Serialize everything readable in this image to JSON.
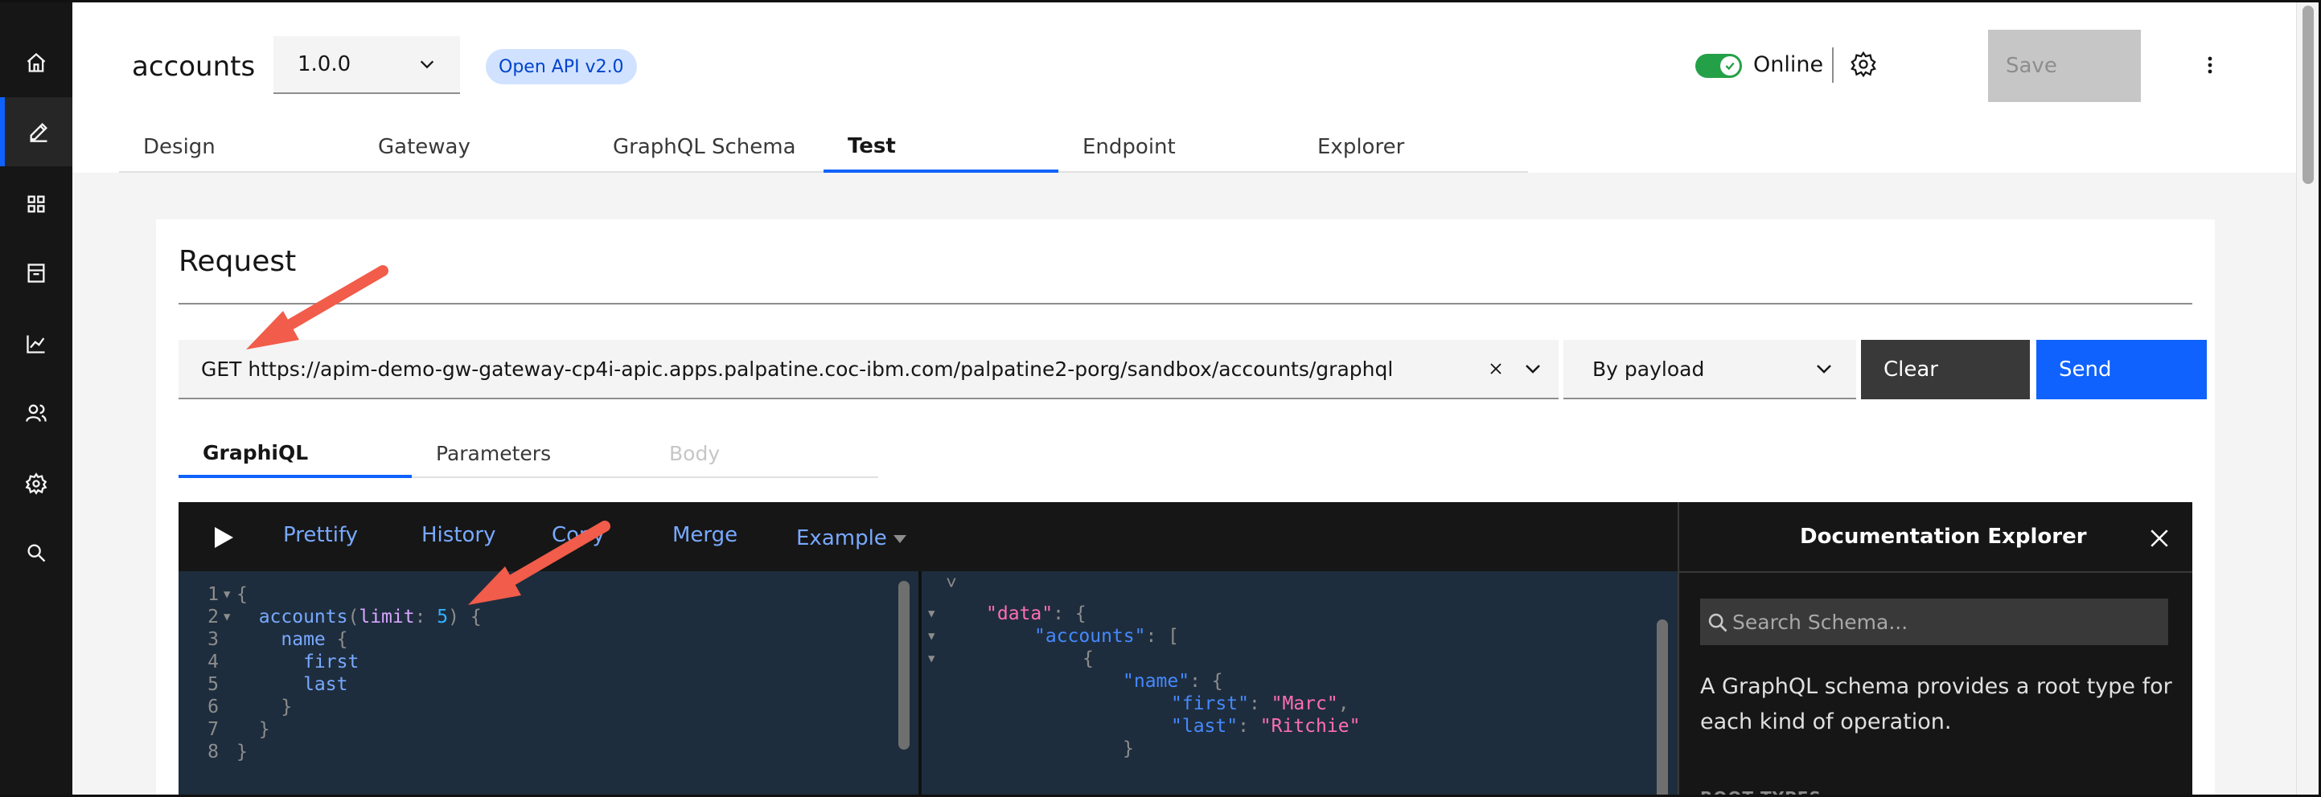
{
  "rail": {
    "items": [
      {
        "icon": "home-icon"
      },
      {
        "icon": "edit-icon",
        "active": true
      },
      {
        "icon": "apps-grid-icon"
      },
      {
        "icon": "archive-icon"
      },
      {
        "icon": "analytics-icon"
      },
      {
        "icon": "users-icon"
      },
      {
        "icon": "settings-icon"
      },
      {
        "icon": "search-icon"
      }
    ]
  },
  "header": {
    "api_name": "accounts",
    "version": "1.0.0",
    "openapi_badge": "Open API v2.0",
    "online_label": "Online",
    "online": true,
    "save_label": "Save"
  },
  "tabs": [
    {
      "label": "Design"
    },
    {
      "label": "Gateway"
    },
    {
      "label": "GraphQL Schema"
    },
    {
      "label": "Test",
      "active": true
    },
    {
      "label": "Endpoint"
    },
    {
      "label": "Explorer"
    }
  ],
  "request": {
    "title": "Request",
    "url": "GET https://apim-demo-gw-gateway-cp4i-apic.apps.palpatine.coc-ibm.com/palpatine2-porg/sandbox/accounts/graphql",
    "payload_mode": "By payload",
    "clear_label": "Clear",
    "send_label": "Send"
  },
  "sub_tabs": [
    {
      "label": "GraphiQL",
      "active": true
    },
    {
      "label": "Parameters"
    },
    {
      "label": "Body",
      "disabled": true
    }
  ],
  "graphiql": {
    "toolbar": {
      "prettify": "Prettify",
      "history": "History",
      "copy": "Copy",
      "merge": "Merge",
      "example": "Example"
    },
    "query_lines": [
      {
        "n": "1",
        "fold": true,
        "parts": [
          {
            "t": "{",
            "c": "p"
          }
        ]
      },
      {
        "n": "2",
        "fold": true,
        "parts": [
          {
            "t": "  accounts",
            "c": "f"
          },
          {
            "t": "(",
            "c": "p"
          },
          {
            "t": "limit",
            "c": "k"
          },
          {
            "t": ": ",
            "c": "p"
          },
          {
            "t": "5",
            "c": "n"
          },
          {
            "t": ") {",
            "c": "p"
          }
        ]
      },
      {
        "n": "3",
        "fold": false,
        "parts": [
          {
            "t": "    name",
            "c": "f"
          },
          {
            "t": " {",
            "c": "p"
          }
        ]
      },
      {
        "n": "4",
        "fold": false,
        "parts": [
          {
            "t": "      first",
            "c": "f"
          }
        ]
      },
      {
        "n": "5",
        "fold": false,
        "parts": [
          {
            "t": "      last",
            "c": "f"
          }
        ]
      },
      {
        "n": "6",
        "fold": false,
        "parts": [
          {
            "t": "    }",
            "c": "p"
          }
        ]
      },
      {
        "n": "7",
        "fold": false,
        "parts": [
          {
            "t": "  }",
            "c": "p"
          }
        ]
      },
      {
        "n": "8",
        "fold": false,
        "parts": [
          {
            "t": "}",
            "c": "p"
          }
        ]
      }
    ],
    "result_lines": [
      {
        "fold": true,
        "indent": 80,
        "parts": [
          {
            "t": "\"data\"",
            "c": "rk"
          },
          {
            "t": ": {",
            "c": "rp"
          }
        ]
      },
      {
        "fold": true,
        "indent": 140,
        "parts": [
          {
            "t": "\"accounts\"",
            "c": "rk2"
          },
          {
            "t": ": [",
            "c": "rp"
          }
        ]
      },
      {
        "fold": true,
        "indent": 200,
        "parts": [
          {
            "t": "{",
            "c": "rp"
          }
        ]
      },
      {
        "fold": false,
        "indent": 250,
        "parts": [
          {
            "t": "\"name\"",
            "c": "rk2"
          },
          {
            "t": ": {",
            "c": "rp"
          }
        ]
      },
      {
        "fold": false,
        "indent": 310,
        "parts": [
          {
            "t": "\"first\"",
            "c": "rk2"
          },
          {
            "t": ": ",
            "c": "rp"
          },
          {
            "t": "\"Marc\"",
            "c": "rs"
          },
          {
            "t": ",",
            "c": "rp"
          }
        ]
      },
      {
        "fold": false,
        "indent": 310,
        "parts": [
          {
            "t": "\"last\"",
            "c": "rk2"
          },
          {
            "t": ": ",
            "c": "rp"
          },
          {
            "t": "\"Ritchie\"",
            "c": "rs"
          }
        ]
      },
      {
        "fold": false,
        "indent": 250,
        "parts": [
          {
            "t": "}",
            "c": "rp"
          }
        ]
      }
    ]
  },
  "doc_explorer": {
    "title": "Documentation Explorer",
    "search_placeholder": "Search Schema...",
    "description": "A GraphQL schema provides a root type for each kind of operation.",
    "section_label": "ROOT TYPES"
  },
  "colors": {
    "accent": "#0f62fe",
    "annotation_arrow": "#f25c4a",
    "online_green": "#24a148"
  }
}
